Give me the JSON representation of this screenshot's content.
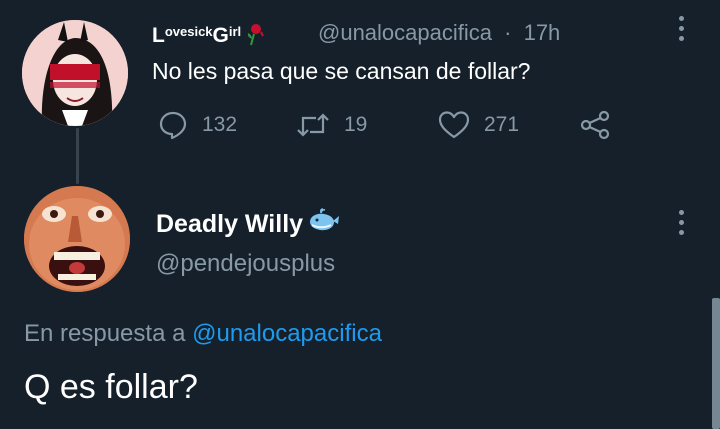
{
  "tweet_original": {
    "display_name_parts": [
      "L",
      "ovesick",
      "G",
      "irl"
    ],
    "handle": "@unalocapacifica",
    "separator": "·",
    "time": "17h",
    "text": "No les pasa que se cansan de follar?",
    "replies": "132",
    "retweets": "19",
    "likes": "271"
  },
  "tweet_reply": {
    "display_name": "Deadly Willy",
    "handle": "@pendejousplus",
    "reply_prefix": "En respuesta a",
    "reply_mention": "@unalocapacifica",
    "text": "Q es follar?"
  },
  "icons": {
    "reply": "speech-bubble-icon",
    "retweet": "retweet-icon",
    "like": "heart-icon",
    "share": "share-icon",
    "more": "vertical-dots-icon",
    "rose": "rose-emoji-icon",
    "whale": "whale-emoji-icon"
  },
  "colors": {
    "background": "#15202b",
    "text": "#ffffff",
    "muted": "#8899a6",
    "link": "#1d9bf0",
    "thread_line": "#38444d"
  }
}
